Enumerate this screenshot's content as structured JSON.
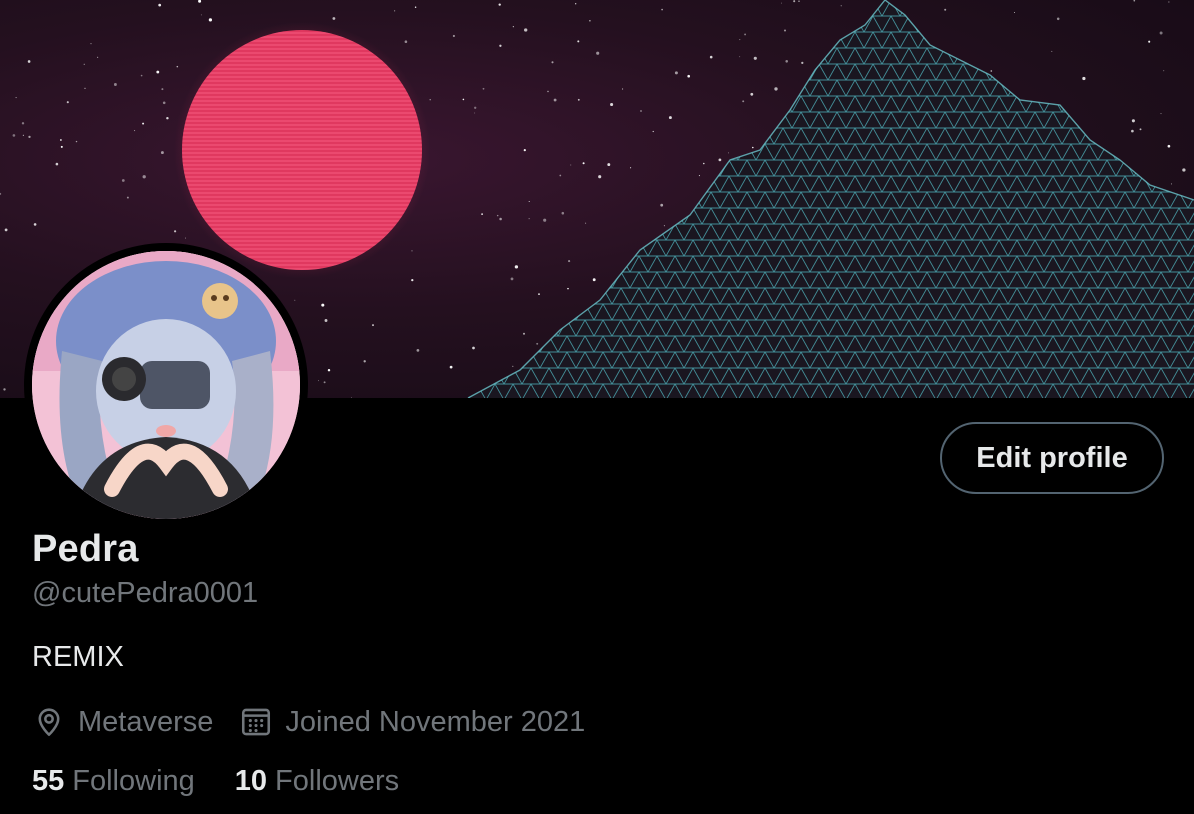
{
  "profile": {
    "name": "Pedra",
    "handle": "@cutePedra0001",
    "bio": "REMIX",
    "location": "Metaverse",
    "joined": "Joined November 2021"
  },
  "actions": {
    "edit_profile_label": "Edit profile"
  },
  "stats": {
    "following_count": "55",
    "following_label": "Following",
    "followers_count": "10",
    "followers_label": "Followers"
  },
  "icons": {
    "location": "location-pin-icon",
    "joined": "calendar-icon"
  },
  "colors": {
    "background": "#000000",
    "primary_text": "#e7e9ea",
    "secondary_text": "#71767b",
    "button_border": "#536471",
    "banner_sun": "#e0385f",
    "banner_mountain": "#4aa3ad"
  }
}
